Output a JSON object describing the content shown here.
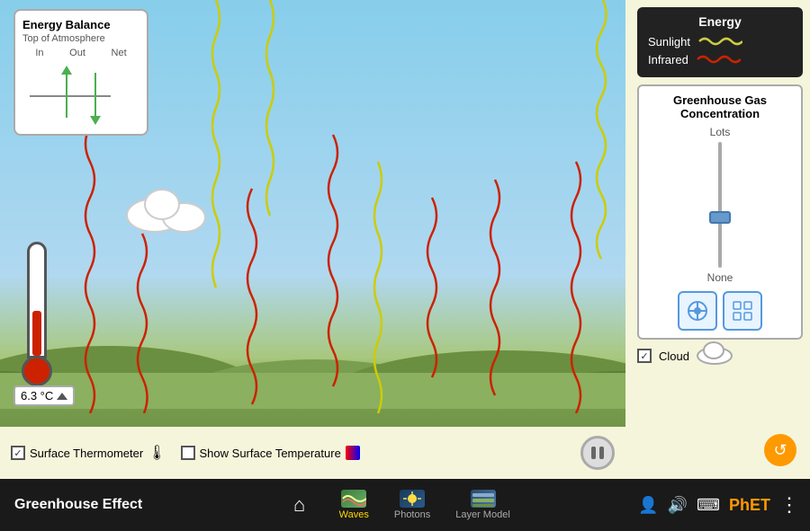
{
  "app": {
    "title": "Greenhouse Effect"
  },
  "energy_balance_panel": {
    "title": "Energy Balance",
    "subtitle": "Top of Atmosphere",
    "col_in": "In",
    "col_out": "Out",
    "col_net": "Net"
  },
  "temperature": {
    "value": "6.3 °C",
    "arrow_label": "▲"
  },
  "energy_legend": {
    "title": "Energy",
    "sunlight_label": "Sunlight",
    "infrared_label": "Infrared"
  },
  "ghg": {
    "title": "Greenhouse Gas Concentration",
    "lots_label": "Lots",
    "none_label": "None",
    "btn1_icon": "⊕",
    "btn2_icon": "▦"
  },
  "checkboxes": {
    "energy_balance": "Energy Balance",
    "surface_thermometer": "Surface Thermometer",
    "show_surface_temp": "Show Surface Temperature",
    "cloud": "Cloud"
  },
  "nav": {
    "home_icon": "🏠",
    "tabs": [
      {
        "label": "Waves",
        "active": true
      },
      {
        "label": "Photons",
        "active": false
      },
      {
        "label": "Layer Model",
        "active": false
      }
    ]
  },
  "toolbar": {
    "person_icon": "👤",
    "sound_icon": "🔊",
    "keyboard_icon": "⌨",
    "menu_icon": "⋮"
  }
}
